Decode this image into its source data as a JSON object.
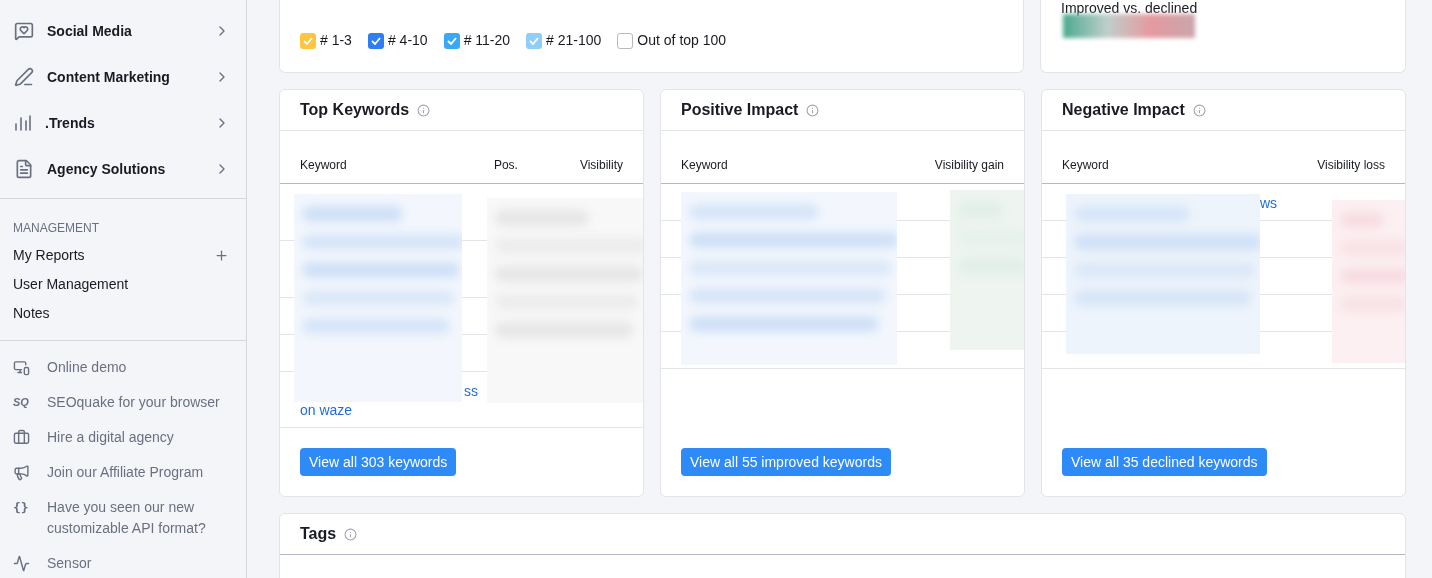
{
  "sidebar": {
    "tools": [
      {
        "label": "Social Media"
      },
      {
        "label": "Content Marketing"
      },
      {
        "label": ".Trends"
      },
      {
        "label": "Agency Solutions"
      }
    ],
    "management": {
      "heading": "MANAGEMENT",
      "items": [
        {
          "label": "My Reports",
          "addable": true
        },
        {
          "label": "User Management",
          "addable": false
        },
        {
          "label": "Notes",
          "addable": false
        }
      ]
    },
    "links": [
      {
        "label": "Online demo"
      },
      {
        "label": "SEOquake for your browser",
        "icon_text": "SQ"
      },
      {
        "label": "Hire a digital agency"
      },
      {
        "label": "Join our Affiliate Program"
      },
      {
        "label": "Have you seen our new customizable API format?",
        "icon_text": "{}"
      },
      {
        "label": "Sensor"
      }
    ]
  },
  "legend": [
    {
      "label": "# 1-3",
      "checked": true,
      "color": "#ffc53d"
    },
    {
      "label": "# 4-10",
      "checked": true,
      "color": "#2e7df6"
    },
    {
      "label": "# 11-20",
      "checked": true,
      "color": "#3aa9f5"
    },
    {
      "label": "# 21-100",
      "checked": true,
      "color": "#8fcdfa"
    },
    {
      "label": "Out of top 100",
      "checked": false,
      "color": "#ffffff"
    }
  ],
  "summary": {
    "caption": "Improved vs. declined"
  },
  "panels": [
    {
      "title": "Top Keywords",
      "kind": "top",
      "columns": [
        "Keyword",
        "Pos.",
        "Visibility"
      ],
      "fragments": [
        "ss",
        "on waze"
      ],
      "button": "View all 303 keywords"
    },
    {
      "title": "Positive Impact",
      "kind": "positive",
      "columns": [
        "Keyword",
        "Visibility gain"
      ],
      "button": "View all 55 improved keywords"
    },
    {
      "title": "Negative Impact",
      "kind": "negative",
      "columns": [
        "Keyword",
        "Visibility loss"
      ],
      "fragments": [
        "ws"
      ],
      "button": "View all 35 declined keywords"
    }
  ],
  "tags": {
    "title": "Tags"
  }
}
